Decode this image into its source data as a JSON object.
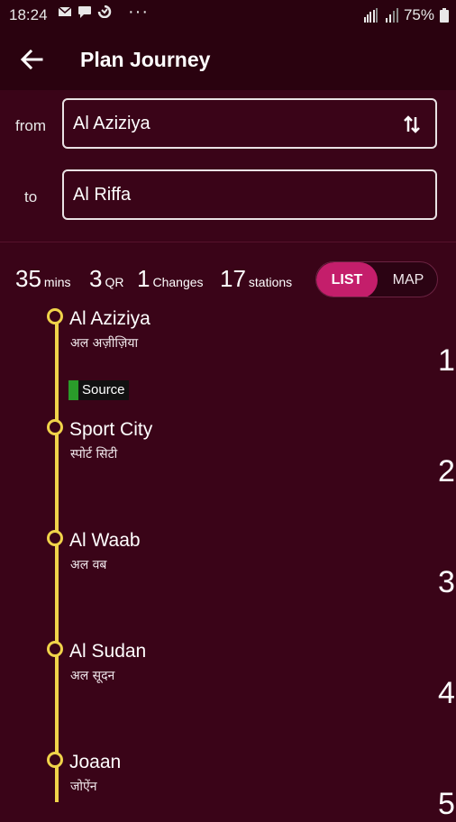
{
  "status_bar": {
    "time": "18:24",
    "dots": "···",
    "battery": "75%"
  },
  "header": {
    "title": "Plan Journey"
  },
  "form": {
    "from_label": "from",
    "from_value": "Al Aziziya",
    "to_label": "to",
    "to_value": "Al Riffa"
  },
  "summary": {
    "mins_value": "35",
    "mins_unit": "mins",
    "fare_value": "3",
    "fare_unit": "QR",
    "changes_value": "1",
    "changes_unit": "Changes",
    "stations_value": "17",
    "stations_unit": "stations"
  },
  "toggle": {
    "list_label": "LIST",
    "map_label": "MAP",
    "selected": "LIST"
  },
  "route": {
    "line_color": "#f0d34a",
    "source_badge": "Source",
    "stations": [
      {
        "name": "Al Aziziya",
        "hindi": "अल अज़ीज़िया",
        "number": "1"
      },
      {
        "name": "Sport City",
        "hindi": "स्पोर्ट सिटी",
        "number": "2"
      },
      {
        "name": "Al Waab",
        "hindi": "अल वब",
        "number": "3"
      },
      {
        "name": "Al Sudan",
        "hindi": "अल सूदन",
        "number": "4"
      },
      {
        "name": "Joaan",
        "hindi": "जोऐंन",
        "number": "5"
      }
    ]
  },
  "colors": {
    "background": "#3a0418",
    "appbar": "#2a020f",
    "accent": "#c41e6b",
    "source_green": "#2a9c2a"
  }
}
